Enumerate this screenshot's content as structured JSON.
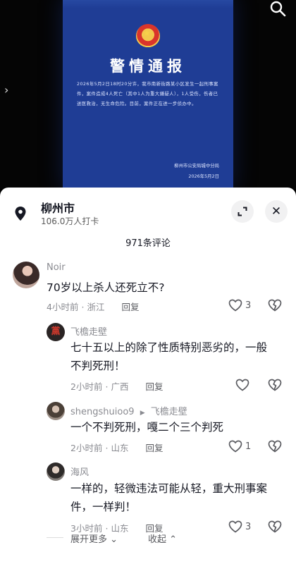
{
  "poster": {
    "title": "警情通报",
    "body": "2026年5月2日18时20分许，我市南新街路某小区发生一起刑事案件，案件造成4人死亡（其中1人为重大嫌疑人），1人受伤，伤者已送医救治，无生命危险。目前，案件正在进一步侦办中。",
    "issuer": "柳州市公安局城中分局",
    "date": "2026年5月2日"
  },
  "location": {
    "name": "柳州市",
    "checkins": "106.0万人打卡"
  },
  "comments_count": "971条评论",
  "comments": [
    {
      "nick": "Noir",
      "text": "70岁以上杀人还死立不?",
      "time": "4小时前",
      "region": "浙江",
      "reply": "回复",
      "likes": "3"
    },
    {
      "nick": "飞檐走壁",
      "text": "七十五以上的除了性质特别恶劣的，一般不判死刑！",
      "time": "2小时前",
      "region": "广西",
      "reply": "回复",
      "likes": ""
    },
    {
      "nick": "shengshuioo9",
      "reply_to": "飞檐走壁",
      "text": "一个不判死刑，嘎二个三个判死",
      "time": "2小时前",
      "region": "山东",
      "reply": "回复",
      "likes": "1"
    },
    {
      "nick": "海风",
      "text": "一样的，轻微违法可能从轻，重大刑事案件，一样判！",
      "time": "3小时前",
      "region": "山东",
      "reply": "回复",
      "likes": "3"
    }
  ],
  "footer": {
    "expand": "展开更多",
    "collapse": "收起"
  },
  "icons": [
    "search-icon",
    "chevron-right-icon",
    "location-pin-icon",
    "expand-icon",
    "close-icon",
    "heart-icon",
    "broken-heart-icon",
    "chevron-down-icon",
    "chevron-up-icon",
    "play-arrow-icon"
  ],
  "colors": {
    "poster_blue": "#1f3d95",
    "sheet_bg": "#ffffff",
    "text": "#161823",
    "meta": "#8a8b91"
  }
}
